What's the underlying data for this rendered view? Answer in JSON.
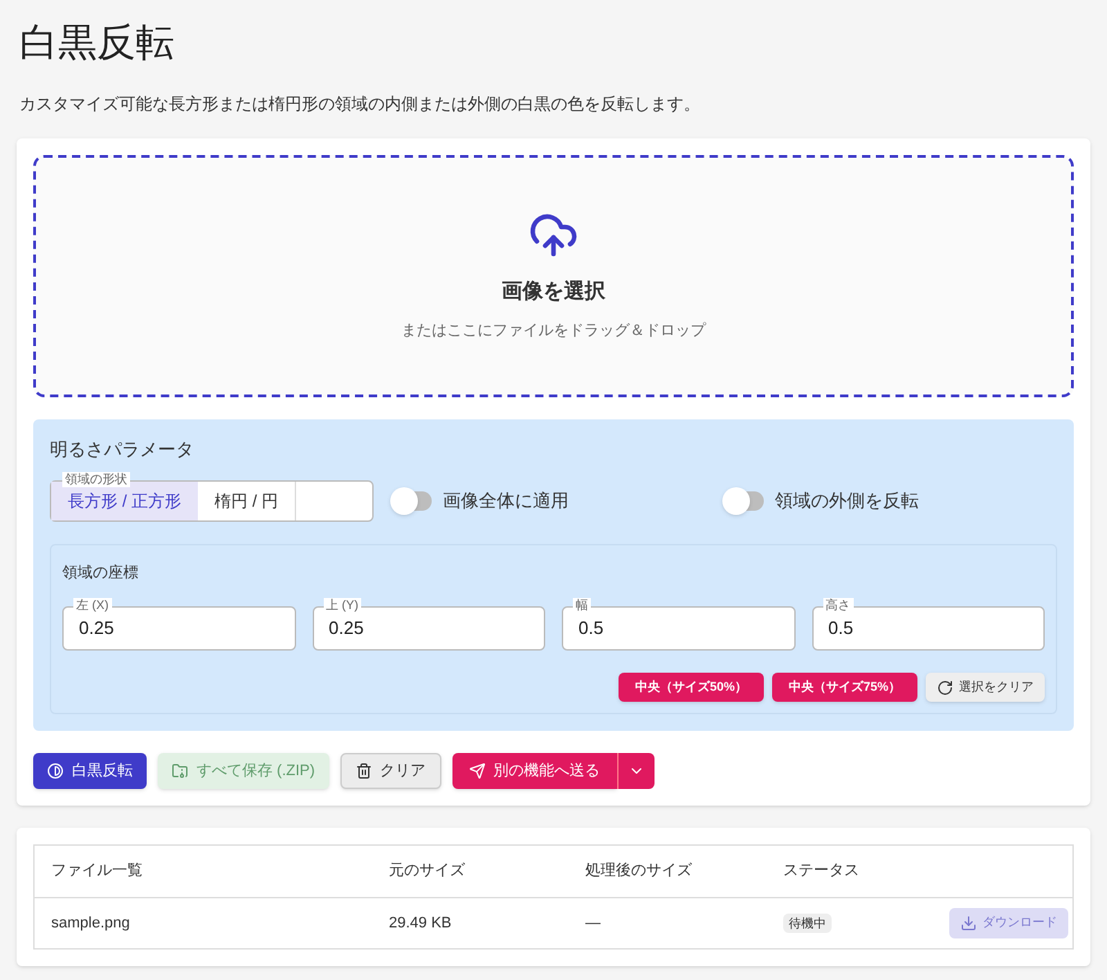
{
  "title": "白黒反転",
  "description": "カスタマイズ可能な長方形または楕円形の領域の内側または外側の白黒の色を反転します。",
  "dropzone": {
    "title": "画像を選択",
    "hint": "またはここにファイルをドラッグ＆ドロップ"
  },
  "params": {
    "title": "明るさパラメータ",
    "shape": {
      "label": "領域の形状",
      "options": [
        {
          "label": "長方形 / 正方形",
          "selected": true
        },
        {
          "label": "楕円 / 円",
          "selected": false
        }
      ]
    },
    "toggles": [
      {
        "label": "画像全体に適用",
        "on": false
      },
      {
        "label": "領域の外側を反転",
        "on": false
      }
    ],
    "coords": {
      "title": "領域の座標",
      "fields": [
        {
          "label": "左 (X)",
          "value": "0.25"
        },
        {
          "label": "上 (Y)",
          "value": "0.25"
        },
        {
          "label": "幅",
          "value": "0.5"
        },
        {
          "label": "高さ",
          "value": "0.5"
        }
      ],
      "buttons": [
        {
          "label": "中央（サイズ50%）",
          "kind": "preset"
        },
        {
          "label": "中央（サイズ75%）",
          "kind": "preset"
        },
        {
          "label": "選択をクリア",
          "kind": "clear"
        }
      ]
    }
  },
  "actions": [
    {
      "label": "白黒反転",
      "kind": "primary",
      "disabled": false
    },
    {
      "label": "すべて保存 (.ZIP)",
      "kind": "zip",
      "disabled": true
    },
    {
      "label": "クリア",
      "kind": "clear",
      "disabled": false
    },
    {
      "label": "別の機能へ送る",
      "kind": "send",
      "disabled": false
    }
  ],
  "table": {
    "columns": [
      "ファイル一覧",
      "元のサイズ",
      "処理後のサイズ",
      "ステータス"
    ],
    "rows": [
      {
        "name": "sample.png",
        "size": "29.49 KB",
        "processed": "—",
        "status": "待機中",
        "download": {
          "label": "ダウンロード",
          "disabled": true
        }
      }
    ]
  }
}
